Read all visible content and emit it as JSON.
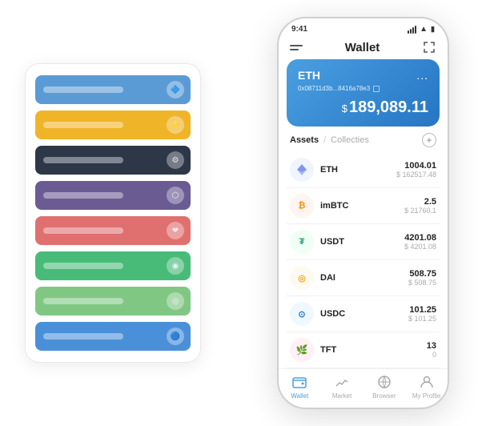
{
  "scene": {
    "background": "#ffffff"
  },
  "card_stack": {
    "rows": [
      {
        "color": "blue",
        "class": "row-blue",
        "icon": "🔷"
      },
      {
        "color": "yellow",
        "class": "row-yellow",
        "icon": "⭐"
      },
      {
        "color": "dark",
        "class": "row-dark",
        "icon": "⚙"
      },
      {
        "color": "purple",
        "class": "row-purple",
        "icon": "💜"
      },
      {
        "color": "red",
        "class": "row-red",
        "icon": "❤"
      },
      {
        "color": "green",
        "class": "row-green",
        "icon": "💚"
      },
      {
        "color": "lightgreen",
        "class": "row-lightgreen",
        "icon": "🌿"
      },
      {
        "color": "blue2",
        "class": "row-blue2",
        "icon": "🔵"
      }
    ]
  },
  "phone": {
    "status_bar": {
      "time": "9:41",
      "signal": "lll",
      "wifi": "WiFi",
      "battery": "🔋"
    },
    "header": {
      "menu_label": "☰",
      "title": "Wallet",
      "expand_label": "⤢"
    },
    "eth_card": {
      "title": "ETH",
      "address": "0x08711d3b...8416a78e3",
      "address_suffix": "⬜",
      "more": "...",
      "balance_symbol": "$",
      "balance": "189,089.11"
    },
    "tabs": {
      "active": "Assets",
      "divider": "/",
      "inactive": "Collecties",
      "add_icon": "+"
    },
    "assets": [
      {
        "name": "ETH",
        "icon_class": "asset-icon-eth",
        "icon_char": "◈",
        "amount": "1004.01",
        "usd": "$ 162517.48"
      },
      {
        "name": "imBTC",
        "icon_class": "asset-icon-imbtc",
        "icon_char": "₿",
        "amount": "2.5",
        "usd": "$ 21760.1"
      },
      {
        "name": "USDT",
        "icon_class": "asset-icon-usdt",
        "icon_char": "₮",
        "amount": "4201.08",
        "usd": "$ 4201.08"
      },
      {
        "name": "DAI",
        "icon_class": "asset-icon-dai",
        "icon_char": "◎",
        "amount": "508.75",
        "usd": "$ 508.75"
      },
      {
        "name": "USDC",
        "icon_class": "asset-icon-usdc",
        "icon_char": "⊙",
        "amount": "101.25",
        "usd": "$ 101.25"
      },
      {
        "name": "TFT",
        "icon_class": "asset-icon-tft",
        "icon_char": "🌿",
        "amount": "13",
        "usd": "0"
      }
    ],
    "nav": [
      {
        "label": "Wallet",
        "active": true
      },
      {
        "label": "Market",
        "active": false
      },
      {
        "label": "Browser",
        "active": false
      },
      {
        "label": "My Profile",
        "active": false
      }
    ]
  }
}
